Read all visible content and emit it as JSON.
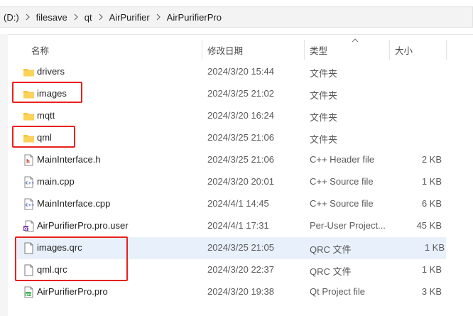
{
  "breadcrumb": [
    "(D:)",
    "filesave",
    "qt",
    "AirPurifier",
    "AirPurifierPro"
  ],
  "columns": {
    "name": "名称",
    "date": "修改日期",
    "type": "类型",
    "size": "大小"
  },
  "files": [
    {
      "icon": "folder-icon",
      "name": "drivers",
      "date": "2024/3/20 15:44",
      "type": "文件夹",
      "size": ""
    },
    {
      "icon": "folder-icon",
      "name": "images",
      "date": "2024/3/25 21:02",
      "type": "文件夹",
      "size": ""
    },
    {
      "icon": "folder-icon",
      "name": "mqtt",
      "date": "2024/3/20 16:24",
      "type": "文件夹",
      "size": ""
    },
    {
      "icon": "folder-icon",
      "name": "qml",
      "date": "2024/3/25 21:06",
      "type": "文件夹",
      "size": ""
    },
    {
      "icon": "cpp-header-file-icon",
      "name": "MainInterface.h",
      "date": "2024/3/25 21:06",
      "type": "C++ Header file",
      "size": "2 KB"
    },
    {
      "icon": "cpp-source-file-icon",
      "name": "main.cpp",
      "date": "2024/3/20 20:01",
      "type": "C++ Source file",
      "size": "1 KB"
    },
    {
      "icon": "cpp-source-file-icon",
      "name": "MainInterface.cpp",
      "date": "2024/4/1 14:45",
      "type": "C++ Source file",
      "size": "6 KB"
    },
    {
      "icon": "qt-user-file-icon",
      "name": "AirPurifierPro.pro.user",
      "date": "2024/4/1 17:31",
      "type": "Per-User Project...",
      "size": "45 KB"
    },
    {
      "icon": "generic-file-icon",
      "name": "images.qrc",
      "date": "2024/3/25 21:05",
      "type": "QRC 文件",
      "size": "1 KB"
    },
    {
      "icon": "generic-file-icon",
      "name": "qml.qrc",
      "date": "2024/3/20 22:37",
      "type": "QRC 文件",
      "size": "1 KB"
    },
    {
      "icon": "qt-project-file-icon",
      "name": "AirPurifierPro.pro",
      "date": "2024/3/20 19:38",
      "type": "Qt Project file",
      "size": "3 KB"
    }
  ],
  "colors": {
    "highlight": "#e8211b",
    "selection": "#e8f1fb",
    "folder": "#f6c443"
  }
}
